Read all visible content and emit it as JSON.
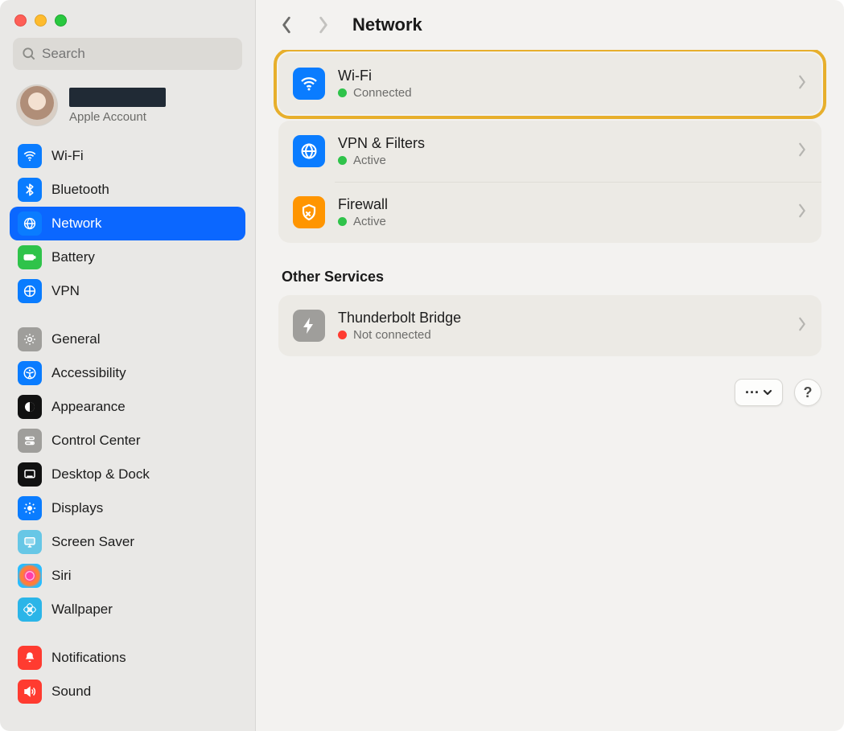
{
  "search": {
    "placeholder": "Search"
  },
  "account": {
    "subtitle": "Apple Account"
  },
  "sidebar": {
    "groups": [
      {
        "items": [
          {
            "id": "wifi",
            "label": "Wi-Fi"
          },
          {
            "id": "bt",
            "label": "Bluetooth"
          },
          {
            "id": "net",
            "label": "Network",
            "selected": true
          },
          {
            "id": "bat",
            "label": "Battery"
          },
          {
            "id": "vpn",
            "label": "VPN"
          }
        ]
      },
      {
        "items": [
          {
            "id": "gen",
            "label": "General"
          },
          {
            "id": "acc",
            "label": "Accessibility"
          },
          {
            "id": "app",
            "label": "Appearance"
          },
          {
            "id": "cc",
            "label": "Control Center"
          },
          {
            "id": "dock",
            "label": "Desktop & Dock"
          },
          {
            "id": "disp",
            "label": "Displays"
          },
          {
            "id": "ss",
            "label": "Screen Saver"
          },
          {
            "id": "siri",
            "label": "Siri"
          },
          {
            "id": "wall",
            "label": "Wallpaper"
          }
        ]
      },
      {
        "items": [
          {
            "id": "notif",
            "label": "Notifications"
          },
          {
            "id": "sound",
            "label": "Sound"
          }
        ]
      }
    ]
  },
  "page": {
    "title": "Network",
    "services": [
      {
        "id": "wifi",
        "title": "Wi-Fi",
        "status": "Connected",
        "status_color": "green",
        "highlighted": true
      },
      {
        "id": "vpn",
        "title": "VPN & Filters",
        "status": "Active",
        "status_color": "green"
      },
      {
        "id": "fw",
        "title": "Firewall",
        "status": "Active",
        "status_color": "green"
      }
    ],
    "other_heading": "Other Services",
    "other_services": [
      {
        "id": "tb",
        "title": "Thunderbolt Bridge",
        "status": "Not connected",
        "status_color": "red"
      }
    ],
    "more_button": "···",
    "help_button": "?"
  }
}
